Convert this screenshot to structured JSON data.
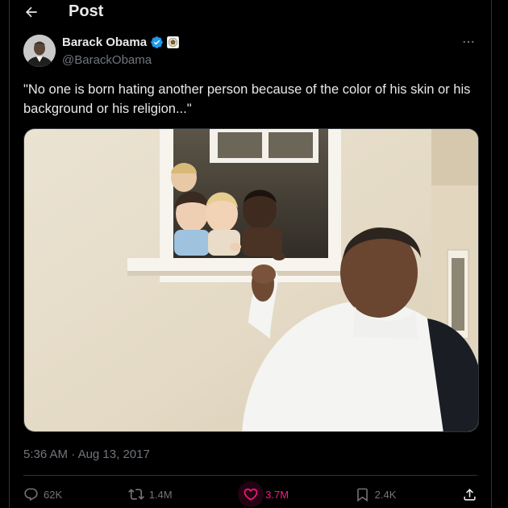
{
  "header": {
    "title": "Post",
    "back_icon": "arrow-left-icon"
  },
  "author": {
    "display_name": "Barack Obama",
    "handle": "@BarackObama",
    "verified_icon": "verified-badge-icon",
    "affiliation_icon": "government-seal-icon",
    "verified_color": "#1d9bf0"
  },
  "tweet": {
    "text": "\"No one is born hating another person because of the color of his skin or his background or his religion...\"",
    "time": "5:36 AM",
    "separator": " · ",
    "date": "Aug 13, 2017"
  },
  "actions": {
    "replies": {
      "icon": "reply-icon",
      "count": "62K"
    },
    "reposts": {
      "icon": "repost-icon",
      "count": "1.4M"
    },
    "likes": {
      "icon": "heart-icon",
      "count": "3.7M",
      "liked": true
    },
    "bookmarks": {
      "icon": "bookmark-icon",
      "count": "2.4K"
    },
    "share": {
      "icon": "share-icon"
    }
  },
  "colors": {
    "background": "#000000",
    "text_primary": "#e7e9ea",
    "text_secondary": "#71767b",
    "border": "#2f3336",
    "like_accent": "#f91880"
  }
}
